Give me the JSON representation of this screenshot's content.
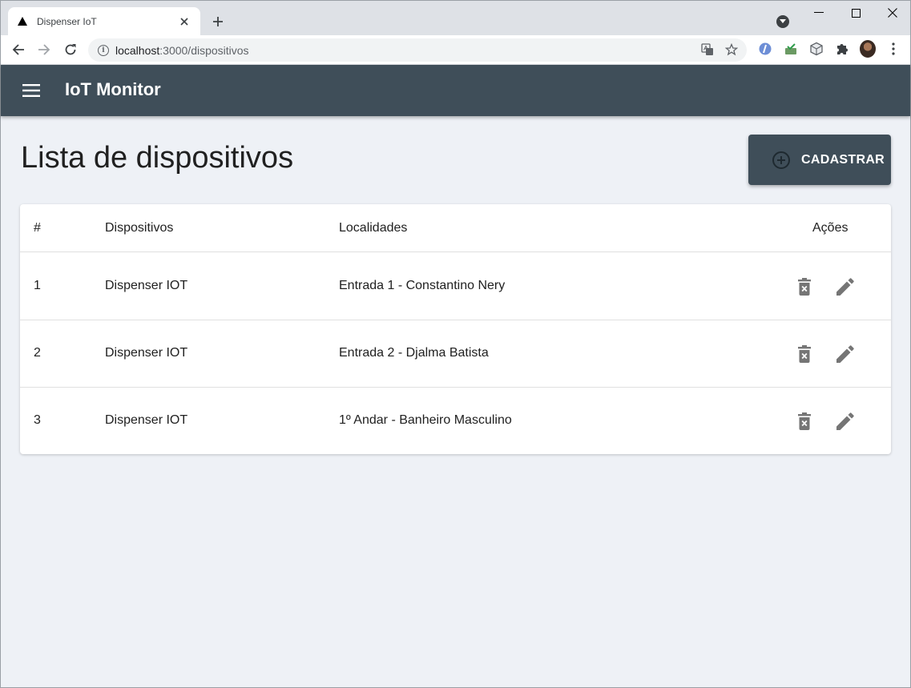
{
  "browser": {
    "tab_title": "Dispenser IoT",
    "url_host": "localhost",
    "url_path": ":3000/dispositivos"
  },
  "appbar": {
    "title": "IoT Monitor"
  },
  "page": {
    "title": "Lista de dispositivos",
    "add_button_label": "CADASTRAR"
  },
  "table": {
    "headers": {
      "num": "#",
      "device": "Dispositivos",
      "location": "Localidades",
      "actions": "Ações"
    },
    "rows": [
      {
        "num": "1",
        "device": "Dispenser IOT",
        "location": "Entrada 1 - Constantino Nery"
      },
      {
        "num": "2",
        "device": "Dispenser IOT",
        "location": "Entrada 2 - Djalma Batista"
      },
      {
        "num": "3",
        "device": "Dispenser IOT",
        "location": "1º Andar - Banheiro Masculino"
      }
    ]
  },
  "colors": {
    "appbar": "#3f4e59",
    "background": "#eef1f6",
    "action_icon": "#757575"
  },
  "icons": {
    "menu": "menu-icon",
    "add": "add-circle-outline-icon",
    "delete": "delete-forever-icon",
    "edit": "pencil-icon"
  }
}
